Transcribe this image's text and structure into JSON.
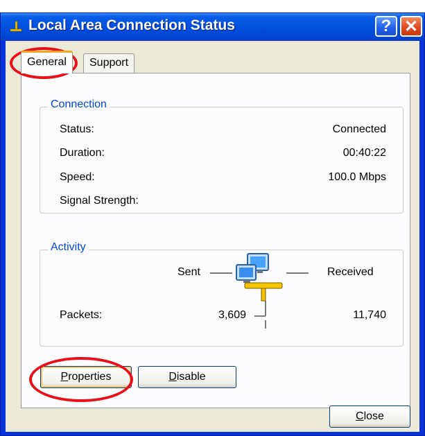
{
  "window": {
    "title": "Local Area Connection Status",
    "help_glyph": "?",
    "close_glyph": "✕"
  },
  "tabs": [
    {
      "label": "General",
      "selected": true
    },
    {
      "label": "Support",
      "selected": false
    }
  ],
  "connection": {
    "title": "Connection",
    "rows": [
      {
        "label": "Status:",
        "value": "Connected"
      },
      {
        "label": "Duration:",
        "value": "00:40:22"
      },
      {
        "label": "Speed:",
        "value": "100.0 Mbps"
      },
      {
        "label": "Signal Strength:",
        "value": ""
      }
    ]
  },
  "activity": {
    "title": "Activity",
    "sent_label": "Sent",
    "received_label": "Received",
    "packets_label": "Packets:",
    "sent_packets": "3,609",
    "received_packets": "11,740"
  },
  "buttons": {
    "properties": {
      "accel": "P",
      "rest": "roperties"
    },
    "disable": {
      "accel": "D",
      "rest": "isable"
    },
    "close": {
      "accel": "C",
      "rest": "lose"
    }
  },
  "colors": {
    "titlebar": "#0250de",
    "dialog_bg": "#ece9d8",
    "group_title": "#0046d5",
    "highlight": "#e8111b"
  }
}
